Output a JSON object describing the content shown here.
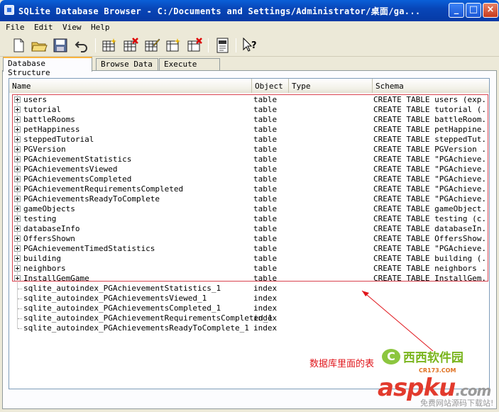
{
  "window": {
    "title": "SQLite Database Browser - C:/Documents and Settings/Administrator/桌面/ga..."
  },
  "titlebar_buttons": {
    "minimize": "_",
    "maximize": "□",
    "close": "×"
  },
  "menu": [
    "File",
    "Edit",
    "View",
    "Help"
  ],
  "toolbar": [
    "new-file-icon",
    "open-folder-icon",
    "save-icon",
    "undo-icon",
    "create-table-icon",
    "delete-table-icon",
    "modify-table-icon",
    "create-index-icon",
    "delete-index-icon",
    "log-icon",
    "whats-this-icon"
  ],
  "tabs": [
    "Database Structure",
    "Browse Data",
    "Execute SQL"
  ],
  "columns": [
    "Name",
    "Object",
    "Type",
    "Schema"
  ],
  "tables": [
    {
      "name": "users",
      "object": "table",
      "schema": "CREATE TABLE users (exp..."
    },
    {
      "name": "tutorial",
      "object": "table",
      "schema": "CREATE TABLE tutorial (..."
    },
    {
      "name": "battleRooms",
      "object": "table",
      "schema": "CREATE TABLE battleRoom..."
    },
    {
      "name": "petHappiness",
      "object": "table",
      "schema": "CREATE TABLE petHappine..."
    },
    {
      "name": "steppedTutorial",
      "object": "table",
      "schema": "CREATE TABLE steppedTut..."
    },
    {
      "name": "PGVersion",
      "object": "table",
      "schema": "CREATE TABLE PGVersion ..."
    },
    {
      "name": "PGAchievementStatistics",
      "object": "table",
      "schema": "CREATE TABLE \"PGAchieve..."
    },
    {
      "name": "PGAchievementsViewed",
      "object": "table",
      "schema": "CREATE TABLE \"PGAchieve..."
    },
    {
      "name": "PGAchievementsCompleted",
      "object": "table",
      "schema": "CREATE TABLE \"PGAchieve..."
    },
    {
      "name": "PGAchievementRequirementsCompleted",
      "object": "table",
      "schema": "CREATE TABLE \"PGAchieve..."
    },
    {
      "name": "PGAchievementsReadyToComplete",
      "object": "table",
      "schema": "CREATE TABLE \"PGAchieve..."
    },
    {
      "name": "gameObjects",
      "object": "table",
      "schema": "CREATE TABLE gameObject..."
    },
    {
      "name": "testing",
      "object": "table",
      "schema": "CREATE TABLE testing (c..."
    },
    {
      "name": "databaseInfo",
      "object": "table",
      "schema": "CREATE TABLE databaseIn..."
    },
    {
      "name": "OffersShown",
      "object": "table",
      "schema": "CREATE TABLE OffersShow..."
    },
    {
      "name": "PGAchievementTimedStatistics",
      "object": "table",
      "schema": "CREATE TABLE \"PGAchieve..."
    },
    {
      "name": "building",
      "object": "table",
      "schema": "CREATE TABLE building (..."
    },
    {
      "name": "neighbors",
      "object": "table",
      "schema": "CREATE TABLE neighbors ..."
    },
    {
      "name": "InstallGemGame",
      "object": "table",
      "schema": "CREATE TABLE InstallGem..."
    }
  ],
  "indexes": [
    {
      "name": "sqlite_autoindex_PGAchievementStatistics_1",
      "object": "index"
    },
    {
      "name": "sqlite_autoindex_PGAchievementsViewed_1",
      "object": "index"
    },
    {
      "name": "sqlite_autoindex_PGAchievementsCompleted_1",
      "object": "index"
    },
    {
      "name": "sqlite_autoindex_PGAchievementRequirementsCompleted_1",
      "object": "index"
    },
    {
      "name": "sqlite_autoindex_PGAchievementsReadyToComplete_1",
      "object": "index"
    }
  ],
  "annotation": "数据库里面的表",
  "watermark": {
    "site1": "西西软件园",
    "site1_sub": "CR173.COM",
    "site2": "aspku",
    "site2_tld": ".com",
    "site2_sub": "免费网站源码下载站!"
  },
  "colors": {
    "highlight_box": "#d9434f",
    "annotation_text": "#e0141a"
  }
}
